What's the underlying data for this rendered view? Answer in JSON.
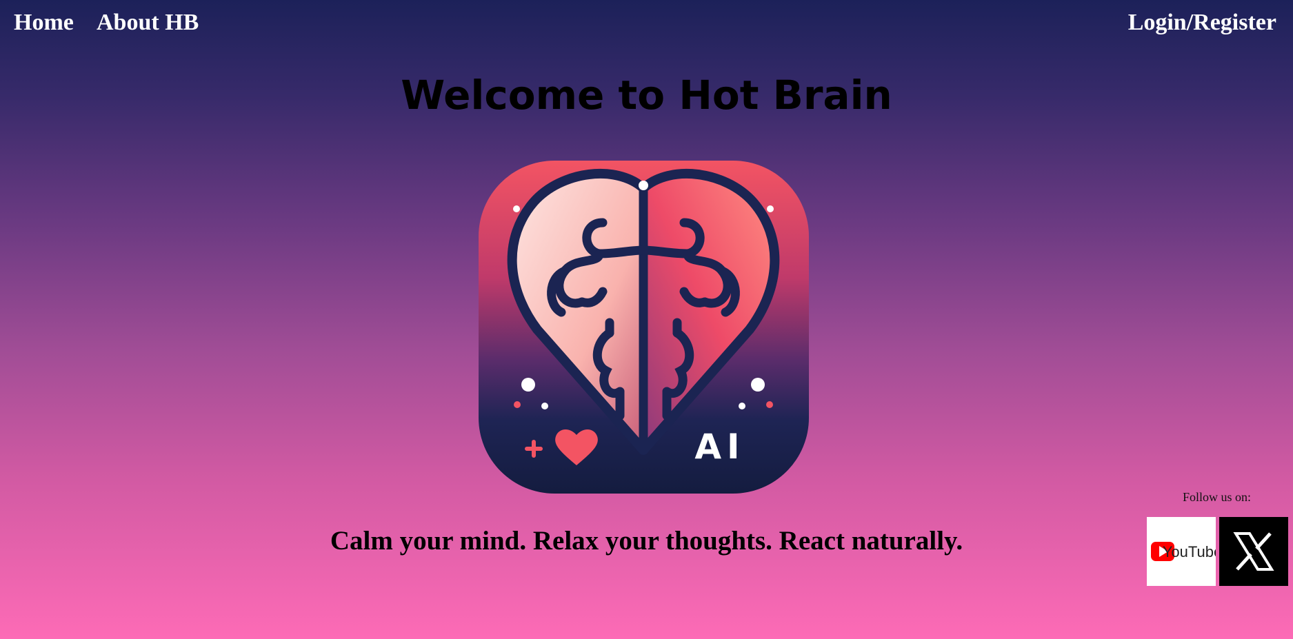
{
  "nav": {
    "home": "Home",
    "about": "About HB",
    "login": "Login/Register"
  },
  "hero": {
    "title": "Welcome to Hot Brain",
    "tagline": "Calm your mind. Relax your thoughts. React naturally.",
    "logo_text": "AI"
  },
  "social": {
    "label": "Follow us on:",
    "youtube_text": "YouTube",
    "x_icon": "x-logo-icon"
  },
  "colors": {
    "bg_top": "#1c2159",
    "bg_bottom": "#fd6bb6",
    "logo_red": "#e8475d",
    "logo_navy": "#1b2452"
  }
}
